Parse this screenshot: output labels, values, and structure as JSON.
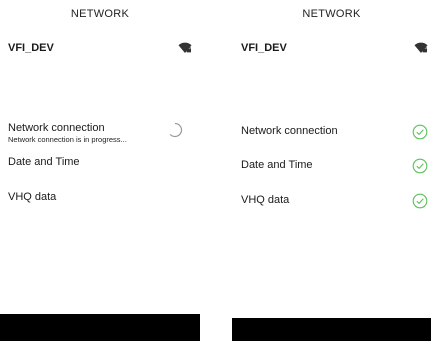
{
  "colors": {
    "success": "#5cc15c",
    "spinner": "#9a9a9a",
    "bottom_bar": "#000000"
  },
  "left": {
    "title": "NETWORK",
    "wifi": {
      "name": "VFI_DEV",
      "icon": "wifi-lock-icon"
    },
    "items": [
      {
        "label": "Network connection",
        "sub": "Network connection is in progress...",
        "status_icon": "spinner-icon"
      },
      {
        "label": "Date and Time"
      },
      {
        "label": "VHQ data"
      }
    ]
  },
  "right": {
    "title": "NETWORK",
    "wifi": {
      "name": "VFI_DEV",
      "icon": "wifi-lock-icon"
    },
    "items": [
      {
        "label": "Network connection",
        "status_icon": "check-circle-icon"
      },
      {
        "label": "Date and Time",
        "status_icon": "check-circle-icon"
      },
      {
        "label": "VHQ data",
        "status_icon": "check-circle-icon"
      }
    ]
  }
}
